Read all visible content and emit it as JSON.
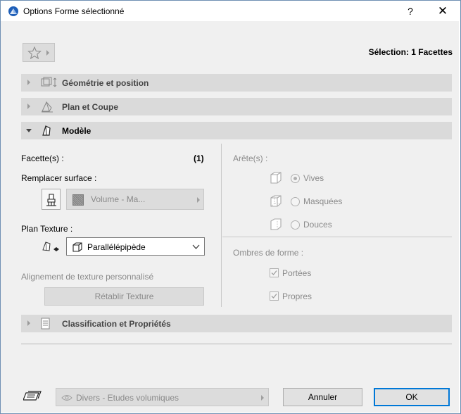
{
  "window": {
    "title": "Options Forme sélectionné",
    "help_label": "?",
    "close_label": "✕"
  },
  "header": {
    "selection_text": "Sélection: 1 Facettes"
  },
  "panels": {
    "geometry": {
      "label": "Géométrie et position",
      "icon": "geometry-icon",
      "expanded": false
    },
    "plan": {
      "label": "Plan et Coupe",
      "icon": "plan-section-icon",
      "expanded": false
    },
    "model": {
      "label": "Modèle",
      "icon": "model-icon",
      "expanded": true
    },
    "classification": {
      "label": "Classification et Propriétés",
      "icon": "document-icon",
      "expanded": false
    }
  },
  "model": {
    "facets_label": "Facette(s) :",
    "facets_count": "(1)",
    "replace_surface_label": "Remplacer surface :",
    "surface_value": "Volume - Ma...",
    "plan_texture_label": "Plan Texture :",
    "texture_value": "Parallélépipède",
    "custom_alignment_label": "Alignement de texture personnalisé",
    "reset_texture_label": "Rétablir Texture",
    "edges_label": "Arête(s) :",
    "edge_options": [
      {
        "label": "Vives",
        "selected": true
      },
      {
        "label": "Masquées",
        "selected": false
      },
      {
        "label": "Douces",
        "selected": false
      }
    ],
    "shadows_label": "Ombres de forme :",
    "shadow_options": [
      {
        "label": "Portées",
        "checked": true
      },
      {
        "label": "Propres",
        "checked": true
      }
    ]
  },
  "footer": {
    "layer_value": "Divers - Etudes volumiques",
    "cancel_label": "Annuler",
    "ok_label": "OK"
  },
  "colors": {
    "accent": "#0078d7",
    "panel_bg": "#dadada",
    "dialog_bg": "#f0f0f0",
    "disabled_text": "#8a8a8a"
  }
}
